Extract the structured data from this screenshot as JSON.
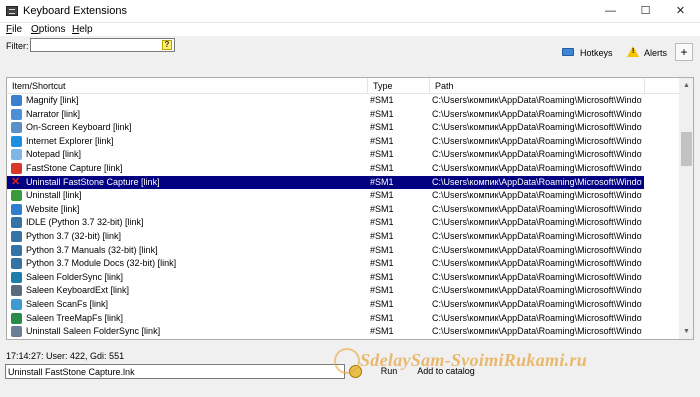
{
  "window": {
    "title": "Keyboard Extensions",
    "controls": {
      "minimize": "—",
      "maximize": "☐",
      "close": "✕"
    }
  },
  "menu": [
    {
      "label": "File",
      "u": "F",
      "rest": "ile"
    },
    {
      "label": "Options",
      "u": "O",
      "rest": "ptions"
    },
    {
      "label": "Help",
      "u": "H",
      "rest": "elp"
    }
  ],
  "filter": {
    "label": "Filter:",
    "value": "",
    "help_icon_text": "?"
  },
  "toolbar": {
    "hotkeys_label": "Hotkeys",
    "alerts_label": "Alerts",
    "plus_label": "+"
  },
  "table": {
    "columns": [
      "Item/Shortcut",
      "Type",
      "Path"
    ],
    "rows": [
      {
        "name": "Magnify [link]",
        "type": "#SM1",
        "path": "C:\\Users\\компик\\AppData\\Roaming\\Microsoft\\Windows\\St...",
        "icon": "magnify-icon",
        "color": "#3b7fd1"
      },
      {
        "name": "Narrator [link]",
        "type": "#SM1",
        "path": "C:\\Users\\компик\\AppData\\Roaming\\Microsoft\\Windows\\St...",
        "icon": "narrator-icon",
        "color": "#4f8fd8"
      },
      {
        "name": "On-Screen Keyboard [link]",
        "type": "#SM1",
        "path": "C:\\Users\\компик\\AppData\\Roaming\\Microsoft\\Windows\\St...",
        "icon": "keyboard-icon",
        "color": "#5a8fc7"
      },
      {
        "name": "Internet Explorer [link]",
        "type": "#SM1",
        "path": "C:\\Users\\компик\\AppData\\Roaming\\Microsoft\\Windows\\St...",
        "icon": "internet-explorer-icon",
        "color": "#1e8fe0"
      },
      {
        "name": "Notepad [link]",
        "type": "#SM1",
        "path": "C:\\Users\\компик\\AppData\\Roaming\\Microsoft\\Windows\\St...",
        "icon": "notepad-icon",
        "color": "#7fb6e6"
      },
      {
        "name": "FastStone Capture [link]",
        "type": "#SM1",
        "path": "C:\\Users\\компик\\AppData\\Roaming\\Microsoft\\Windows\\St...",
        "icon": "faststone-icon",
        "color": "#d9372a"
      },
      {
        "name": "Uninstall FastStone Capture [link]",
        "type": "#SM1",
        "path": "C:\\Users\\компик\\AppData\\Roaming\\Microsoft\\Windows\\St...",
        "icon": "uninstall-x-icon",
        "color": "#e02020",
        "selected": true
      },
      {
        "name": "Uninstall [link]",
        "type": "#SM1",
        "path": "C:\\Users\\компик\\AppData\\Roaming\\Microsoft\\Windows\\St...",
        "icon": "uninstall-icon",
        "color": "#3a9b3a"
      },
      {
        "name": "Website [link]",
        "type": "#SM1",
        "path": "C:\\Users\\компик\\AppData\\Roaming\\Microsoft\\Windows\\St...",
        "icon": "globe-icon",
        "color": "#2f7fd0"
      },
      {
        "name": "IDLE (Python 3.7 32-bit) [link]",
        "type": "#SM1",
        "path": "C:\\Users\\компик\\AppData\\Roaming\\Microsoft\\Windows\\St...",
        "icon": "python-icon",
        "color": "#3572a5"
      },
      {
        "name": "Python 3.7 (32-bit) [link]",
        "type": "#SM1",
        "path": "C:\\Users\\компик\\AppData\\Roaming\\Microsoft\\Windows\\St...",
        "icon": "python-icon",
        "color": "#3572a5"
      },
      {
        "name": "Python 3.7 Manuals (32-bit) [link]",
        "type": "#SM1",
        "path": "C:\\Users\\компик\\AppData\\Roaming\\Microsoft\\Windows\\St...",
        "icon": "python-icon",
        "color": "#3572a5"
      },
      {
        "name": "Python 3.7 Module Docs (32-bit) [link]",
        "type": "#SM1",
        "path": "C:\\Users\\компик\\AppData\\Roaming\\Microsoft\\Windows\\St...",
        "icon": "python-icon",
        "color": "#3572a5"
      },
      {
        "name": "Saleen FolderSync [link]",
        "type": "#SM1",
        "path": "C:\\Users\\компик\\AppData\\Roaming\\Microsoft\\Windows\\St...",
        "icon": "foldersync-icon",
        "color": "#1d7fa8"
      },
      {
        "name": "Saleen KeyboardExt [link]",
        "type": "#SM1",
        "path": "C:\\Users\\компик\\AppData\\Roaming\\Microsoft\\Windows\\St...",
        "icon": "keyboardext-icon",
        "color": "#5a6b7d"
      },
      {
        "name": "Saleen ScanFs [link]",
        "type": "#SM1",
        "path": "C:\\Users\\компик\\AppData\\Roaming\\Microsoft\\Windows\\St...",
        "icon": "scanfs-icon",
        "color": "#3f9ad4"
      },
      {
        "name": "Saleen TreeMapFs [link]",
        "type": "#SM1",
        "path": "C:\\Users\\компик\\AppData\\Roaming\\Microsoft\\Windows\\St...",
        "icon": "treemapfs-icon",
        "color": "#2b8c4a"
      },
      {
        "name": "Uninstall Saleen FolderSync [link]",
        "type": "#SM1",
        "path": "C:\\Users\\компик\\AppData\\Roaming\\Microsoft\\Windows\\St...",
        "icon": "uninstall-icon",
        "color": "#6a7f95"
      }
    ]
  },
  "status": {
    "text": "17:14:27: User: 422, Gdi: 551"
  },
  "command": {
    "value": "Uninstall FastStone Capture.lnk",
    "run_label": "Run",
    "catalog_label": "Add to catalog"
  },
  "watermark": {
    "text": "SdelaySam-SvoimiRukami.ru"
  },
  "colors": {
    "selection": "#000080",
    "background": "#f0f0f0"
  }
}
